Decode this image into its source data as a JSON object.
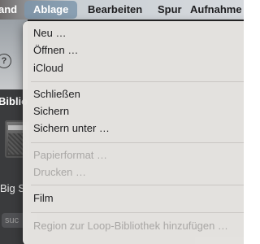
{
  "menubar": {
    "items": [
      {
        "label": "and"
      },
      {
        "label": "Ablage"
      },
      {
        "label": "Bearbeiten"
      },
      {
        "label": "Spur"
      },
      {
        "label": "Aufnahme"
      }
    ]
  },
  "background": {
    "help_icon_glyph": "?",
    "library_title": "Biblio",
    "preset_label": "Big S",
    "search_placeholder": "suc"
  },
  "menu": {
    "items": [
      {
        "label": "Neu …",
        "enabled": true
      },
      {
        "label": "Öffnen …",
        "enabled": true
      },
      {
        "label": "iCloud",
        "enabled": true
      },
      {
        "label": "Schließen",
        "enabled": true
      },
      {
        "label": "Sichern",
        "enabled": true
      },
      {
        "label": "Sichern unter …",
        "enabled": true
      },
      {
        "label": "Papierformat …",
        "enabled": false
      },
      {
        "label": "Drucken …",
        "enabled": false
      },
      {
        "label": "Film",
        "enabled": true
      },
      {
        "label": "Region zur Loop-Bibliothek hinzufügen …",
        "enabled": false
      }
    ]
  }
}
